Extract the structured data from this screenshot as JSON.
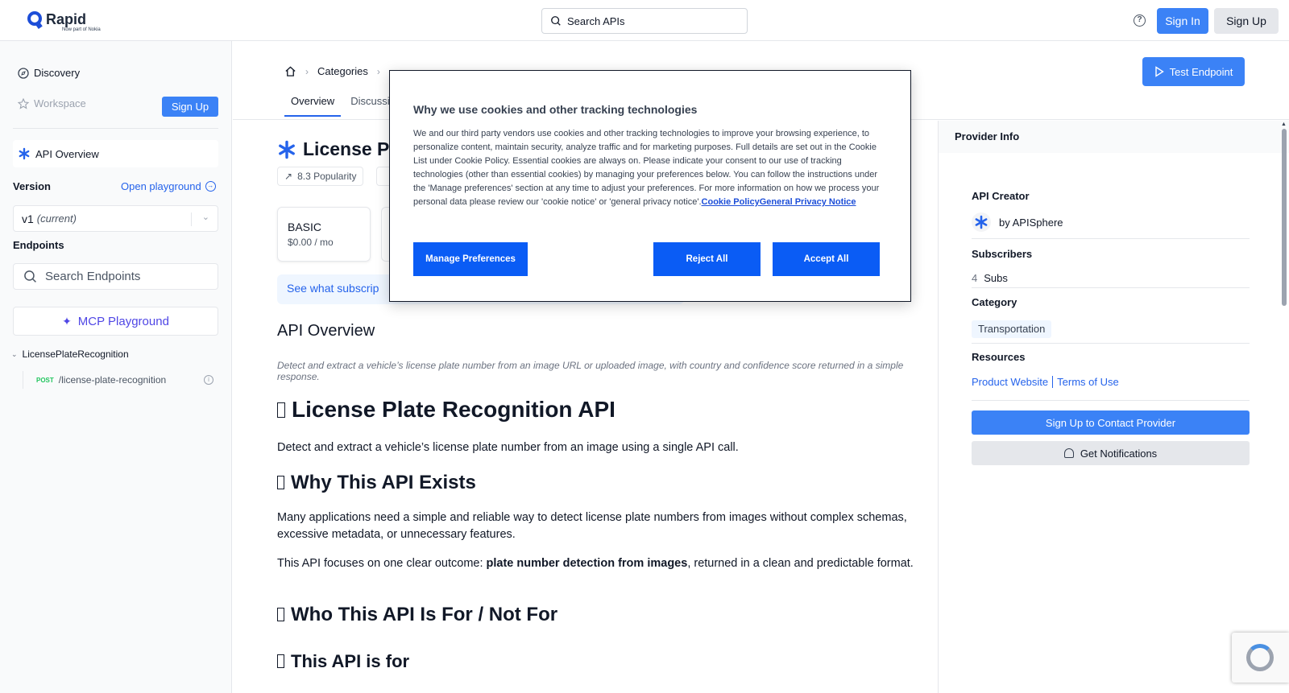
{
  "header": {
    "logo_name": "Rapid",
    "logo_sub": "Now part of Nokia",
    "search_placeholder": "Search APIs",
    "help_glyph": "?",
    "sign_in": "Sign In",
    "sign_up": "Sign Up"
  },
  "sidebar": {
    "discovery": "Discovery",
    "workspace": "Workspace",
    "sign_up": "Sign Up",
    "api_overview": "API Overview",
    "version_label": "Version",
    "open_playground": "Open playground",
    "version_value": "v1",
    "version_note": "(current)",
    "endpoints_label": "Endpoints",
    "endpoints_search": "Search Endpoints",
    "mcp_playground": "MCP Playground",
    "group_name": "LicensePlateRecognition",
    "endpoint_method": "POST",
    "endpoint_path": "/license-plate-recognition"
  },
  "breadcrumb": {
    "categories": "Categories"
  },
  "tabs": [
    "Overview",
    "Discussi"
  ],
  "test_endpoint": "Test Endpoint",
  "content": {
    "api_title": "License P",
    "popularity": "8.3 Popularity",
    "plan_name": "BASIC",
    "plan_price": "$0.00 / mo",
    "subs_text": "See what subscrip",
    "overview_title": "API Overview",
    "description": "Detect and extract a vehicle’s license plate number from an image URL or uploaded image, with country and confidence score returned in a simple response.",
    "h1": "License Plate Recognition API",
    "p1": "Detect and extract a vehicle’s license plate number from an image using a single API call.",
    "h2_why": "Why This API Exists",
    "p2": "Many applications need a simple and reliable way to detect license plate numbers from images without complex schemas, excessive metadata, or unnecessary features.",
    "p3_pre": "This API focuses on one clear outcome: ",
    "p3_bold": "plate number detection from images",
    "p3_post": ", returned in a clean and predictable format.",
    "h2_who": "Who This API Is For / Not For",
    "h3_for": "This API is for"
  },
  "provider": {
    "header": "Provider Info",
    "creator_label": "API Creator",
    "creator": "by APISphere",
    "subscribers_label": "Subscribers",
    "subscribers_count": "4",
    "subscribers_unit": "Subs",
    "category_label": "Category",
    "category": "Transportation",
    "resources_label": "Resources",
    "product_website": "Product Website",
    "terms": "Terms of Use",
    "contact": "Sign Up to Contact Provider",
    "notifications": "Get Notifications"
  },
  "cookie": {
    "title": "Why we use cookies and other tracking technologies",
    "body": "We and our third party vendors use cookies and other tracking technologies to improve your browsing experience, to personalize content, maintain security, analyze traffic and for marketing purposes. Full details are set out in the Cookie List under Cookie Policy. Essential cookies are always on. Please indicate your consent to our use of tracking technologies (other than essential cookies) by managing your preferences below. You can follow the instructions under the 'Manage preferences' section at any time to adjust your preferences. For more information on how we process your personal data please review our 'cookie notice' or 'general privacy notice'.",
    "link_policy": "Cookie Policy",
    "link_privacy": "General Privacy Notice",
    "manage": "Manage Preferences",
    "reject": "Reject All",
    "accept": "Accept All"
  },
  "colors": {
    "accent": "#3b82f6",
    "cookie_button": "#0a5cf5",
    "brand": "#1d4ed8"
  }
}
